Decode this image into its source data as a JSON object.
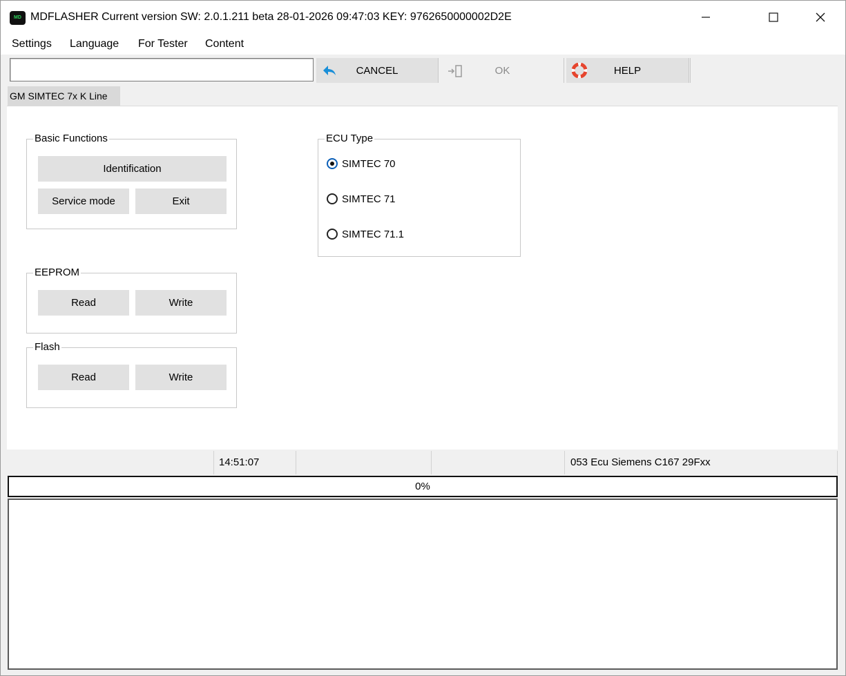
{
  "window": {
    "app_icon_text": "MD",
    "title": "MDFLASHER  Current version SW: 2.0.1.211 beta 28-01-2026 09:47:03  KEY: 9762650000002D2E",
    "controls": {
      "minimize_icon": "minimize-icon",
      "maximize_icon": "maximize-icon",
      "close_icon": "close-icon"
    }
  },
  "menu": [
    {
      "label": "Settings"
    },
    {
      "label": "Language"
    },
    {
      "label": "For Tester"
    },
    {
      "label": "Content"
    }
  ],
  "toolbar": {
    "input_value": "",
    "cancel_label": "CANCEL",
    "ok_label": "OK",
    "help_label": "HELP",
    "cancel_icon": "undo-arrow-icon",
    "ok_icon": "exit-door-icon",
    "help_icon": "lifebuoy-icon",
    "accent_color": "#1a8fd8"
  },
  "tab": {
    "label": "GM SIMTEC 7x K Line"
  },
  "basic_functions": {
    "title": "Basic Functions",
    "identification_label": "Identification",
    "service_mode_label": "Service mode",
    "exit_label": "Exit"
  },
  "eeprom": {
    "title": "EEPROM",
    "read_label": "Read",
    "write_label": "Write"
  },
  "flash": {
    "title": "Flash",
    "read_label": "Read",
    "write_label": "Write"
  },
  "ecu_type": {
    "title": "ECU Type",
    "options": [
      {
        "label": "SIMTEC 70",
        "checked": true
      },
      {
        "label": "SIMTEC 71",
        "checked": false
      },
      {
        "label": "SIMTEC 71.1",
        "checked": false
      }
    ]
  },
  "status": {
    "cell1": "",
    "time": "14:51:07",
    "cell3": "",
    "cell4": "",
    "ecu_info": "053 Ecu Siemens C167 29Fxx"
  },
  "progress": {
    "value": 0,
    "label": "0%"
  },
  "log": {
    "text": ""
  }
}
